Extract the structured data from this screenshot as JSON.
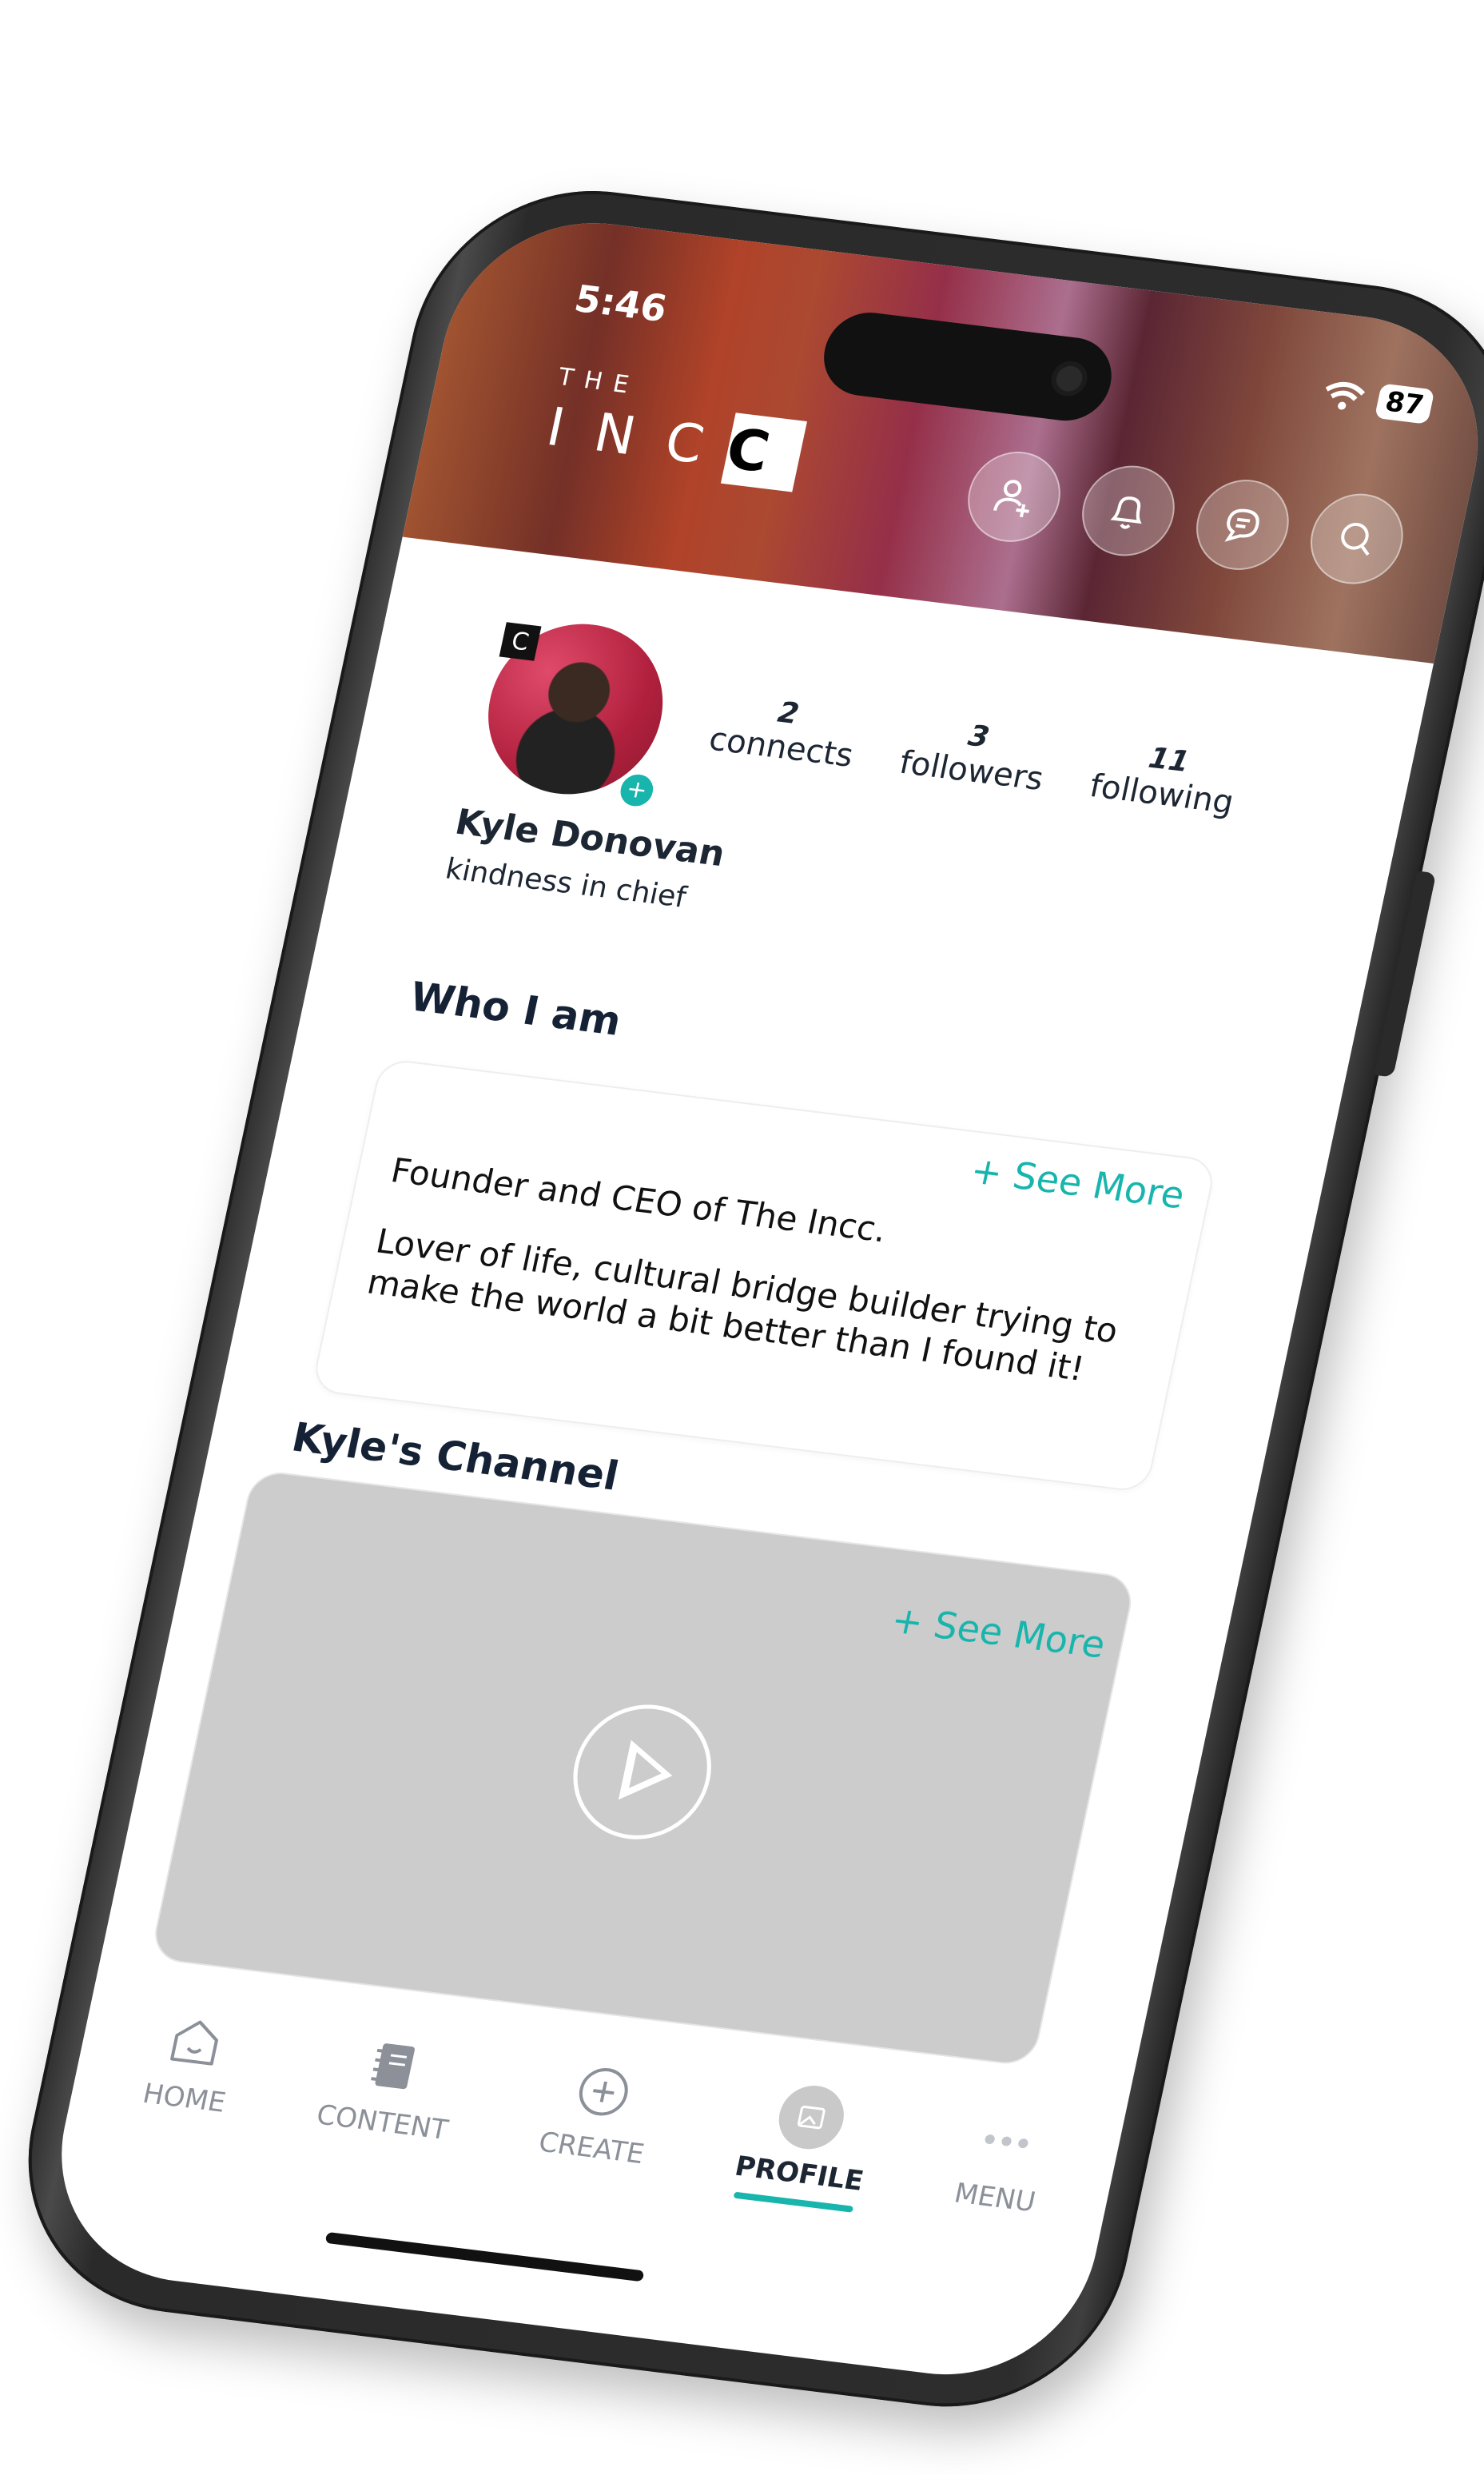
{
  "status_bar": {
    "time": "5:46",
    "battery": "87"
  },
  "brand": {
    "the": "THE",
    "inc": "INC",
    "mark": "C"
  },
  "header_icons": [
    "add-user-icon",
    "bell-icon",
    "chat-icon",
    "search-icon"
  ],
  "profile": {
    "name": "Kyle Donovan",
    "tagline": "kindness in chief",
    "stats": [
      {
        "value": "2",
        "label": "connects"
      },
      {
        "value": "3",
        "label": "followers"
      },
      {
        "value": "11",
        "label": "following"
      }
    ]
  },
  "who_i_am": {
    "title": "Who I am",
    "see_more": "+ See More",
    "line1": "Founder and CEO of The Incc.",
    "line2": "Lover of life, cultural bridge builder trying to make the world a bit better than I found it!"
  },
  "channel": {
    "title": "Kyle's Channel",
    "see_more": "+ See More"
  },
  "tabs": [
    {
      "label": "HOME",
      "icon": "home-icon"
    },
    {
      "label": "CONTENT",
      "icon": "notebook-icon"
    },
    {
      "label": "CREATE",
      "icon": "plus-circle-icon"
    },
    {
      "label": "PROFILE",
      "icon": "profile-image-icon",
      "active": true
    },
    {
      "label": "MENU",
      "icon": "more-dots-icon"
    }
  ],
  "colors": {
    "accent": "#18b5ad",
    "text": "#1d2633",
    "video_placeholder": "#cccccc"
  }
}
